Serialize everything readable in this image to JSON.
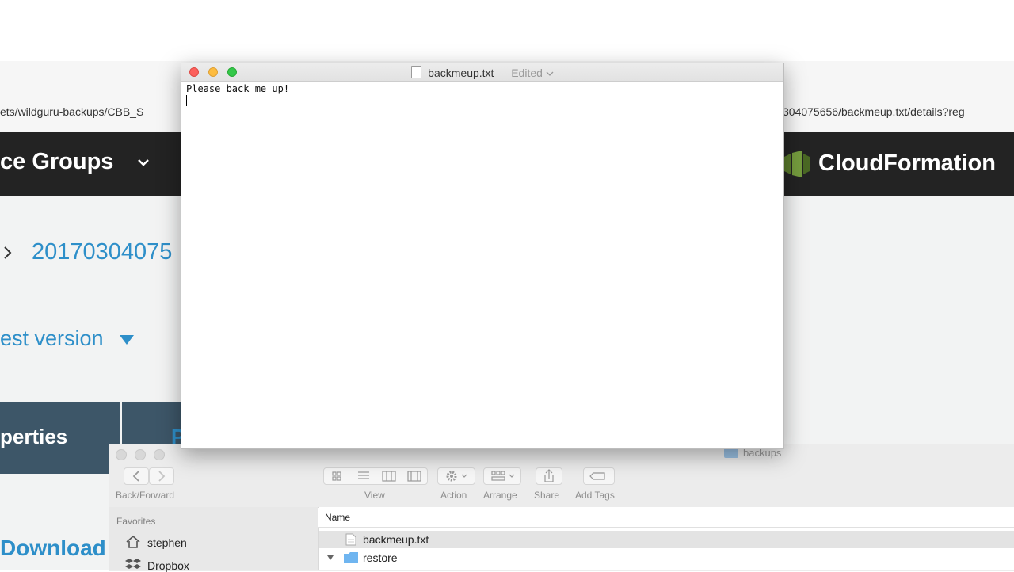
{
  "browser": {
    "url_left": "ets/wildguru-backups/CBB_S",
    "url_right": "304075656/backmeup.txt/details?reg"
  },
  "aws": {
    "nav_groups": "ce Groups",
    "cloudformation": "CloudFormation",
    "breadcrumb_id": "20170304075",
    "latest_version": "est version",
    "tab_properties": "perties",
    "tab_second": "P",
    "download": "Download"
  },
  "textedit": {
    "filename": "backmeup.txt",
    "separator": "—",
    "edited": "Edited",
    "content": "Please back me up!"
  },
  "finder": {
    "title": "backups",
    "toolbar": {
      "back_forward": "Back/Forward",
      "view": "View",
      "action": "Action",
      "arrange": "Arrange",
      "share": "Share",
      "add_tags": "Add Tags"
    },
    "sidebar": {
      "section": "Favorites",
      "items": [
        "stephen",
        "Dropbox"
      ]
    },
    "columns": {
      "name": "Name"
    },
    "rows": [
      "backmeup.txt",
      "restore"
    ]
  },
  "colors": {
    "aws_header": "#232323",
    "aws_link": "#2e8fc9",
    "tab_bg": "#3d5668",
    "traffic_close": "#fc605c",
    "traffic_min": "#fdbc40",
    "traffic_max": "#34c84a",
    "folder": "#6fb5f0"
  }
}
